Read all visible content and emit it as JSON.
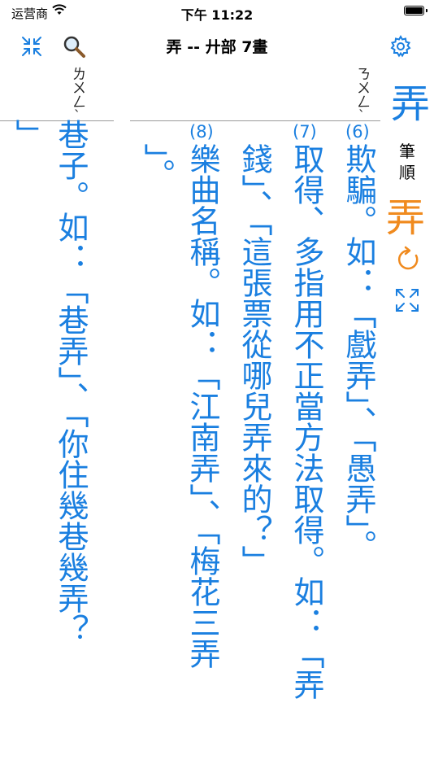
{
  "status_bar": {
    "carrier": "运营商",
    "time": "下午 11:22"
  },
  "nav": {
    "title": "弄 -- 廾部 7畫"
  },
  "sidebar": {
    "char": "弄",
    "bopomofo": "ㄋㄨㄥˋ",
    "stroke_label_1": "筆",
    "stroke_label_2": "順",
    "stroke_char": "弄"
  },
  "entries": {
    "left_col_bopomofo": "ㄌㄨㄥˋ",
    "col_a": "」",
    "col_b": "巷子。如：「巷弄」、「你住幾巷幾弄？",
    "col_c": "」。",
    "col_d": "樂曲名稱。如：「江南弄」、「梅花三弄",
    "col_e": "錢」、「這張票從哪兒弄來的？」",
    "col_f": "取得、多指用不正當方法取得。如：「弄",
    "col_g": "欺騙。如：「戲弄」、「愚弄」。",
    "num_8": "(8)",
    "num_7": "(7)",
    "num_6": "(6)"
  },
  "colors": {
    "accent": "#1a7fe0",
    "stroke": "#f08a1e"
  }
}
